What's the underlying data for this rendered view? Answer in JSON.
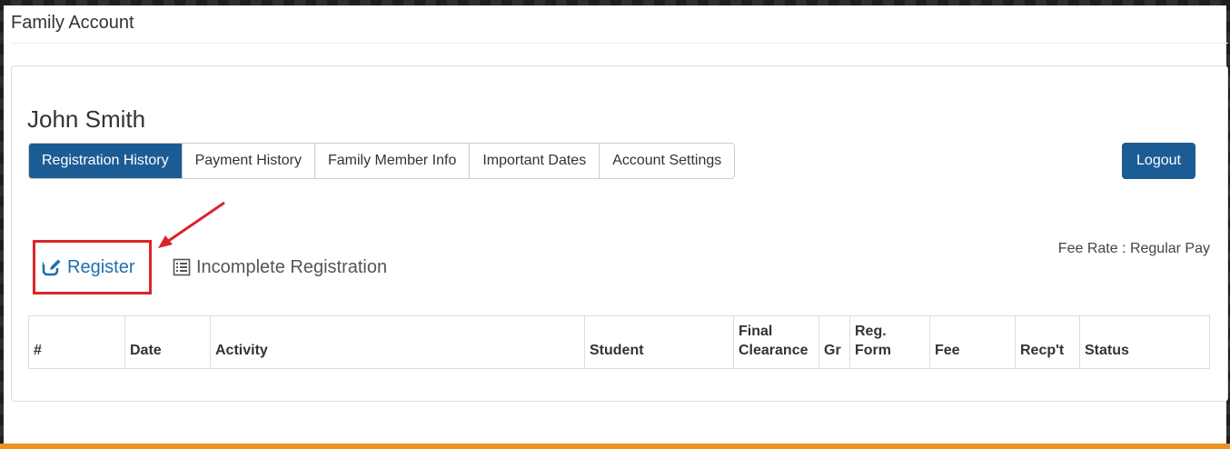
{
  "page": {
    "title": "Family Account"
  },
  "account": {
    "name": "John Smith"
  },
  "tabs": [
    {
      "label": "Registration History",
      "active": true
    },
    {
      "label": "Payment History",
      "active": false
    },
    {
      "label": "Family Member Info",
      "active": false
    },
    {
      "label": "Important Dates",
      "active": false
    },
    {
      "label": "Account Settings",
      "active": false
    }
  ],
  "logout": {
    "label": "Logout"
  },
  "actions": {
    "register": {
      "label": "Register",
      "icon": "edit-icon"
    },
    "incomplete": {
      "label": "Incomplete Registration",
      "icon": "list-icon"
    }
  },
  "fee_rate": {
    "text": "Fee Rate : Regular Pay"
  },
  "table": {
    "headers": [
      {
        "line1": "",
        "line2": "#"
      },
      {
        "line1": "",
        "line2": "Date"
      },
      {
        "line1": "",
        "line2": "Activity"
      },
      {
        "line1": "",
        "line2": "Student"
      },
      {
        "line1": "Final",
        "line2": "Clearance"
      },
      {
        "line1": "",
        "line2": "Gr"
      },
      {
        "line1": "Reg.",
        "line2": "Form"
      },
      {
        "line1": "",
        "line2": "Fee"
      },
      {
        "line1": "",
        "line2": "Recp't"
      },
      {
        "line1": "",
        "line2": "Status"
      }
    ]
  },
  "colors": {
    "primary": "#1c5c94",
    "link": "#1f6fae",
    "highlight": "#d9252a",
    "footer_bar": "#f0901e"
  }
}
